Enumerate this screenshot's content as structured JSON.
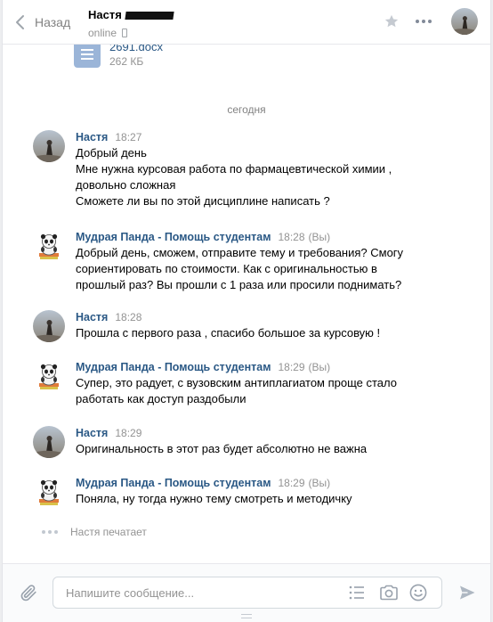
{
  "header": {
    "back_label": "Назад",
    "peer_name": "Настя",
    "peer_status": "online"
  },
  "attachment": {
    "file_name": "2691.docx",
    "file_size": "262 КБ"
  },
  "date_separator": "сегодня",
  "messages": [
    {
      "author": "Настя",
      "time": "18:27",
      "you": "",
      "lines": [
        "Добрый день",
        "Мне нужна курсовая работа по фармацевтической химии ,",
        "довольно сложная",
        "Сможете ли вы по этой дисциплине написать ?"
      ]
    },
    {
      "author": "Мудрая Панда - Помощь студентам",
      "time": "18:28",
      "you": "(Вы)",
      "lines": [
        "Добрый день, сможем, отправите тему и требования? Смогу",
        "сориентировать по стоимости. Как с оригинальностью в",
        "прошлый раз? Вы прошли с 1 раза или просили поднимать?"
      ]
    },
    {
      "author": "Настя",
      "time": "18:28",
      "you": "",
      "lines": [
        "Прошла с первого раза , спасибо большое за курсовую !"
      ]
    },
    {
      "author": "Мудрая Панда - Помощь студентам",
      "time": "18:29",
      "you": "(Вы)",
      "lines": [
        "Супер, это радует, с вузовским антиплагиатом проще стало",
        "работать как доступ раздобыли"
      ]
    },
    {
      "author": "Настя",
      "time": "18:29",
      "you": "",
      "lines": [
        "Оригинальность в этот раз будет абсолютно не важна"
      ]
    },
    {
      "author": "Мудрая Панда - Помощь студентам",
      "time": "18:29",
      "you": "(Вы)",
      "lines": [
        "Поняла, ну тогда нужно тему смотреть и методичку"
      ]
    }
  ],
  "typing_text": "Настя печатает",
  "composer": {
    "placeholder": "Напишите сообщение..."
  },
  "colors": {
    "link": "#2a5885",
    "muted": "#939393",
    "doc_icon": "#9bb5d8",
    "background": "#edeef0"
  },
  "icons": [
    "chevron-left-icon",
    "phone-icon",
    "star-icon",
    "more-icon",
    "document-icon",
    "paperclip-icon",
    "list-icon",
    "camera-icon",
    "smile-icon",
    "send-icon"
  ]
}
